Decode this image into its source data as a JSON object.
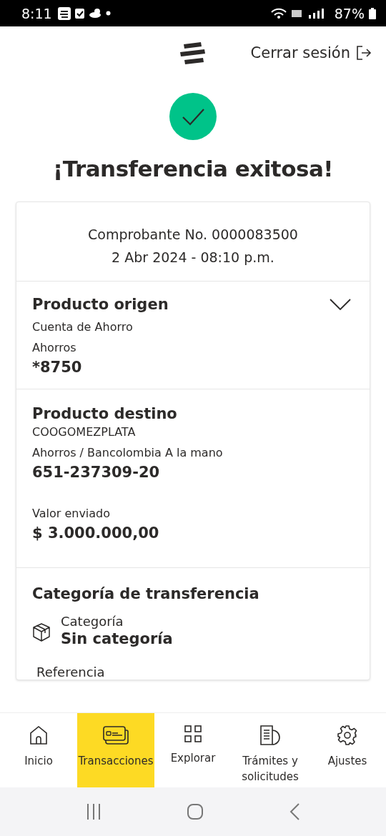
{
  "status_bar": {
    "time": "8:11",
    "battery": "87%"
  },
  "header": {
    "logout": "Cerrar sesión"
  },
  "title": "¡Transferencia exitosa!",
  "receipt": {
    "number": "Comprobante No. 0000083500",
    "date": "2 Abr 2024 - 08:10 p.m."
  },
  "origin": {
    "title": "Producto origen",
    "expanded": false,
    "account_type": "Cuenta de Ahorro",
    "subtype": "Ahorros",
    "number": "*8750"
  },
  "destination": {
    "title": "Producto destino",
    "name": "COOGOMEZPLATA",
    "detail": "Ahorros / Bancolombia A la mano",
    "number": "651-237309-20",
    "amount_label": "Valor enviado",
    "amount": "$ 3.000.000,00"
  },
  "category": {
    "title": "Categoría de transferencia",
    "label": "Categoría",
    "value": "Sin categoría",
    "next_label": "Referencia"
  },
  "bottom_nav": [
    {
      "label": "Inicio",
      "kind": "home",
      "selected": false
    },
    {
      "label": "Transacciones",
      "kind": "transactions",
      "selected": true
    },
    {
      "label": "Explorar",
      "kind": "explore",
      "selected": false
    },
    {
      "label": "Trámites y solicitudes",
      "kind": "requests",
      "selected": false
    },
    {
      "label": "Ajustes",
      "kind": "settings",
      "selected": false
    }
  ]
}
